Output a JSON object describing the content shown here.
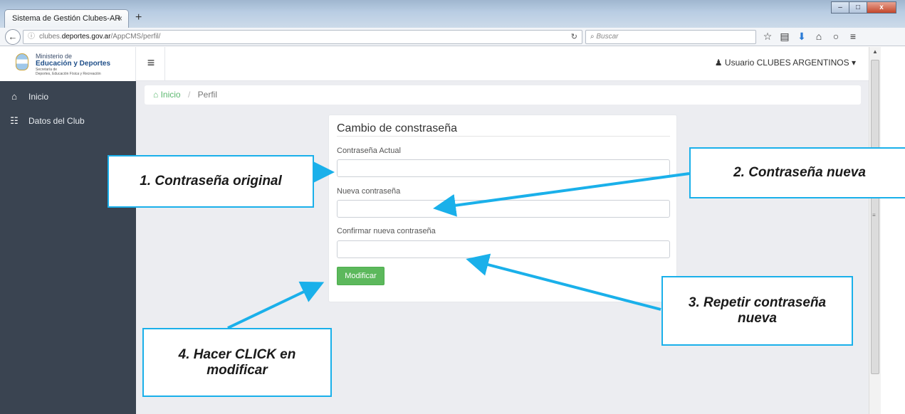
{
  "browser": {
    "tab_title": "Sistema de Gestión Clubes-AR",
    "tab_close": "×",
    "new_tab": "+",
    "url_prefix": "clubes.",
    "url_host": "deportes.gov.ar",
    "url_path": "/AppCMS/perfil/",
    "search_placeholder": "Buscar",
    "win_minimize": "–",
    "win_maximize": "□",
    "win_close": "x"
  },
  "logo": {
    "line1": "Ministerio de",
    "line2": "Educación y Deportes",
    "line3": "Secretaría de",
    "line4": "Deportes, Educación Física y Recreación"
  },
  "header": {
    "user_label": "Usuario CLUBES ARGENTINOS",
    "user_caret": "▾"
  },
  "sidebar": {
    "items": [
      {
        "label": "Inicio",
        "icon": "home-icon"
      },
      {
        "label": "Datos del Club",
        "icon": "bank-icon"
      }
    ]
  },
  "breadcrumb": {
    "home": "Inicio",
    "separator": "/",
    "current": "Perfil"
  },
  "form": {
    "title": "Cambio de constraseña",
    "fields": [
      {
        "label": "Contraseña Actual",
        "value": ""
      },
      {
        "label": "Nueva contraseña",
        "value": ""
      },
      {
        "label": "Confirmar nueva contraseña",
        "value": ""
      }
    ],
    "submit_label": "Modificar"
  },
  "annotations": {
    "step1": "1. Contraseña original",
    "step2": "2. Contraseña nueva",
    "step3": "3. Repetir contraseña nueva",
    "step4": "4. Hacer CLICK en modificar",
    "color": "#1ab0ea"
  },
  "colors": {
    "sidebar_bg": "#3a4451",
    "page_bg": "#ecedf1",
    "accent_green": "#5cb85c",
    "link_green": "#5cb86f"
  }
}
